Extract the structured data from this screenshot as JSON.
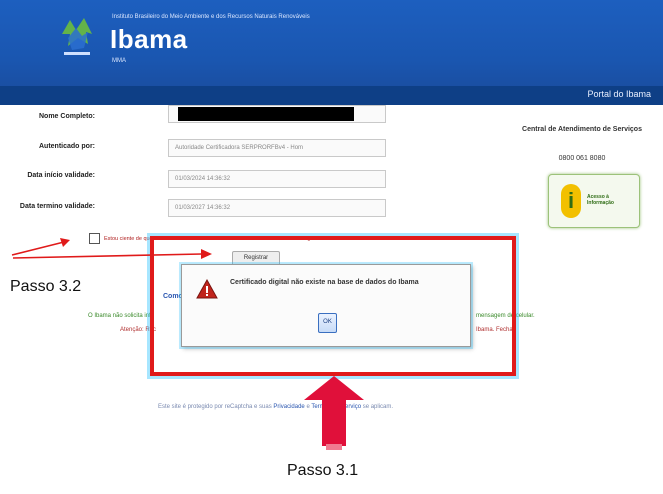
{
  "header": {
    "org_line": "Instituto Brasileiro do Meio Ambiente e dos Recursos Naturais Renováveis",
    "brand": "Ibama",
    "sub_brand": "MMA",
    "portal_link": "Portal do Ibama",
    "color": "#1a56b0"
  },
  "form": {
    "fields": [
      {
        "label": "Nome Completo:",
        "value": ""
      },
      {
        "label": "Autenticado por:",
        "value": "Autoridade Certificadora SERPRORFBv4 - Hom"
      },
      {
        "label": "Data início validade:",
        "value": "01/03/2024 14:36:32"
      },
      {
        "label": "Data termino validade:",
        "value": "01/03/2027 14:36:32"
      }
    ],
    "checkbox_label": "Estou ciente de que os dados acima estarão associados ao meu novo certificado digital",
    "register_button": "Registrar"
  },
  "side": {
    "central_title": "Central de Atendimento de Serviços",
    "phone": "0800 061 8080",
    "info_button": "Acesso à Informação"
  },
  "background": {
    "blue_text": "Como a",
    "green_text_left": "O Ibama não solicita inf",
    "green_text_right": "mensagem de celular.",
    "attention_left": "Atenção: Rec",
    "attention_right": "Ibama. Fechar.",
    "footer_left": "Este site é protegido por reCaptcha e suas",
    "footer_privacy": "Privacidade",
    "footer_and": "e",
    "footer_terms": "Termos de Serviço",
    "footer_tail": "se aplicam."
  },
  "dialog": {
    "message": "Certificado digital não existe na base de dados do Ibama",
    "ok_label": "OK"
  },
  "annotations": {
    "step_3_2": "Passo 3.2",
    "step_3_1": "Passo 3.1",
    "highlight_color": "#e01a1a"
  }
}
